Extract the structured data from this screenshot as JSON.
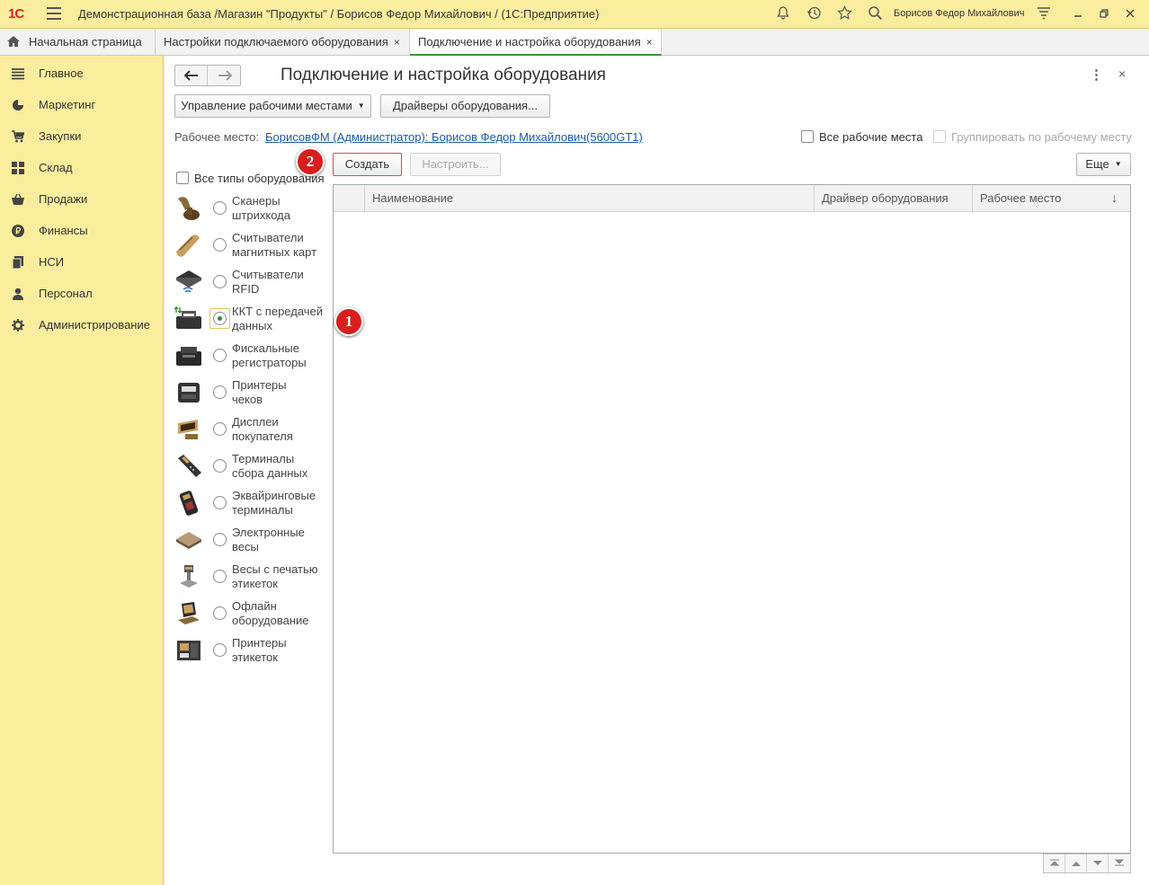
{
  "titlebar": {
    "logo": "1С",
    "title": "Демонстрационная база /Магазин \"Продукты\" / Борисов Федор Михайлович /  (1С:Предприятие)",
    "user": "Борисов Федор Михайлович"
  },
  "tabs": [
    {
      "label": "Начальная страница"
    },
    {
      "label": "Настройки подключаемого оборудования",
      "close": "×"
    },
    {
      "label": "Подключение и настройка оборудования",
      "close": "×"
    }
  ],
  "sidebar": {
    "items": [
      {
        "label": "Главное",
        "icon": "list-icon"
      },
      {
        "label": "Маркетинг",
        "icon": "pie-chart-icon"
      },
      {
        "label": "Закупки",
        "icon": "cart-icon"
      },
      {
        "label": "Склад",
        "icon": "grid-icon"
      },
      {
        "label": "Продажи",
        "icon": "basket-icon"
      },
      {
        "label": "Финансы",
        "icon": "ruble-icon"
      },
      {
        "label": "НСИ",
        "icon": "book-icon"
      },
      {
        "label": "Персонал",
        "icon": "person-icon"
      },
      {
        "label": "Администрирование",
        "icon": "gear-icon"
      }
    ]
  },
  "page": {
    "title": "Подключение и настройка оборудования",
    "nav_back": "🡐",
    "nav_forward": "🡒",
    "more": "⋮",
    "close": "×"
  },
  "toolbar": {
    "workplaces_button": "Управление рабочими местами",
    "drivers_button": "Драйверы оборудования...",
    "create_button": "Создать",
    "configure_button": "Настроить...",
    "more_button": "Еще"
  },
  "workplace": {
    "label": "Рабочее место:",
    "value": "БорисовФМ (Администратор): Борисов Федор Михайлович(5600GT1)",
    "all_workplaces_label": "Все рабочие места",
    "group_by_workplace_label": "Группировать по рабочему месту"
  },
  "equipment": {
    "all_types_label": "Все типы оборудования",
    "types": [
      {
        "line1": "Сканеры",
        "line2": "штрихкода",
        "selected": false
      },
      {
        "line1": "Считыватели",
        "line2": "магнитных карт",
        "selected": false
      },
      {
        "line1": "Считыватели",
        "line2": "RFID",
        "selected": false
      },
      {
        "line1": "ККТ с передачей",
        "line2": "данных",
        "selected": true
      },
      {
        "line1": "Фискальные",
        "line2": "регистраторы",
        "selected": false
      },
      {
        "line1": "Принтеры",
        "line2": "чеков",
        "selected": false
      },
      {
        "line1": "Дисплеи",
        "line2": "покупателя",
        "selected": false
      },
      {
        "line1": "Терминалы",
        "line2": "сбора данных",
        "selected": false
      },
      {
        "line1": "Эквайринговые",
        "line2": "терминалы",
        "selected": false
      },
      {
        "line1": "Электронные",
        "line2": "весы",
        "selected": false
      },
      {
        "line1": "Весы с печатью",
        "line2": "этикеток",
        "selected": false
      },
      {
        "line1": "Офлайн",
        "line2": "оборудование",
        "selected": false
      },
      {
        "line1": "Принтеры",
        "line2": "этикеток",
        "selected": false
      }
    ]
  },
  "grid": {
    "columns": [
      "Наименование",
      "Драйвер оборудования",
      "Рабочее место"
    ],
    "sort_indicator": "↓",
    "rows": []
  },
  "callouts": [
    "1",
    "2"
  ],
  "colors": {
    "titlebar_bg": "#fbed9e",
    "sidebar_bg": "#fbed9e",
    "accent_green": "#3e8f3e",
    "link": "#1a5aa8",
    "callout_red": "#d91e1e"
  }
}
